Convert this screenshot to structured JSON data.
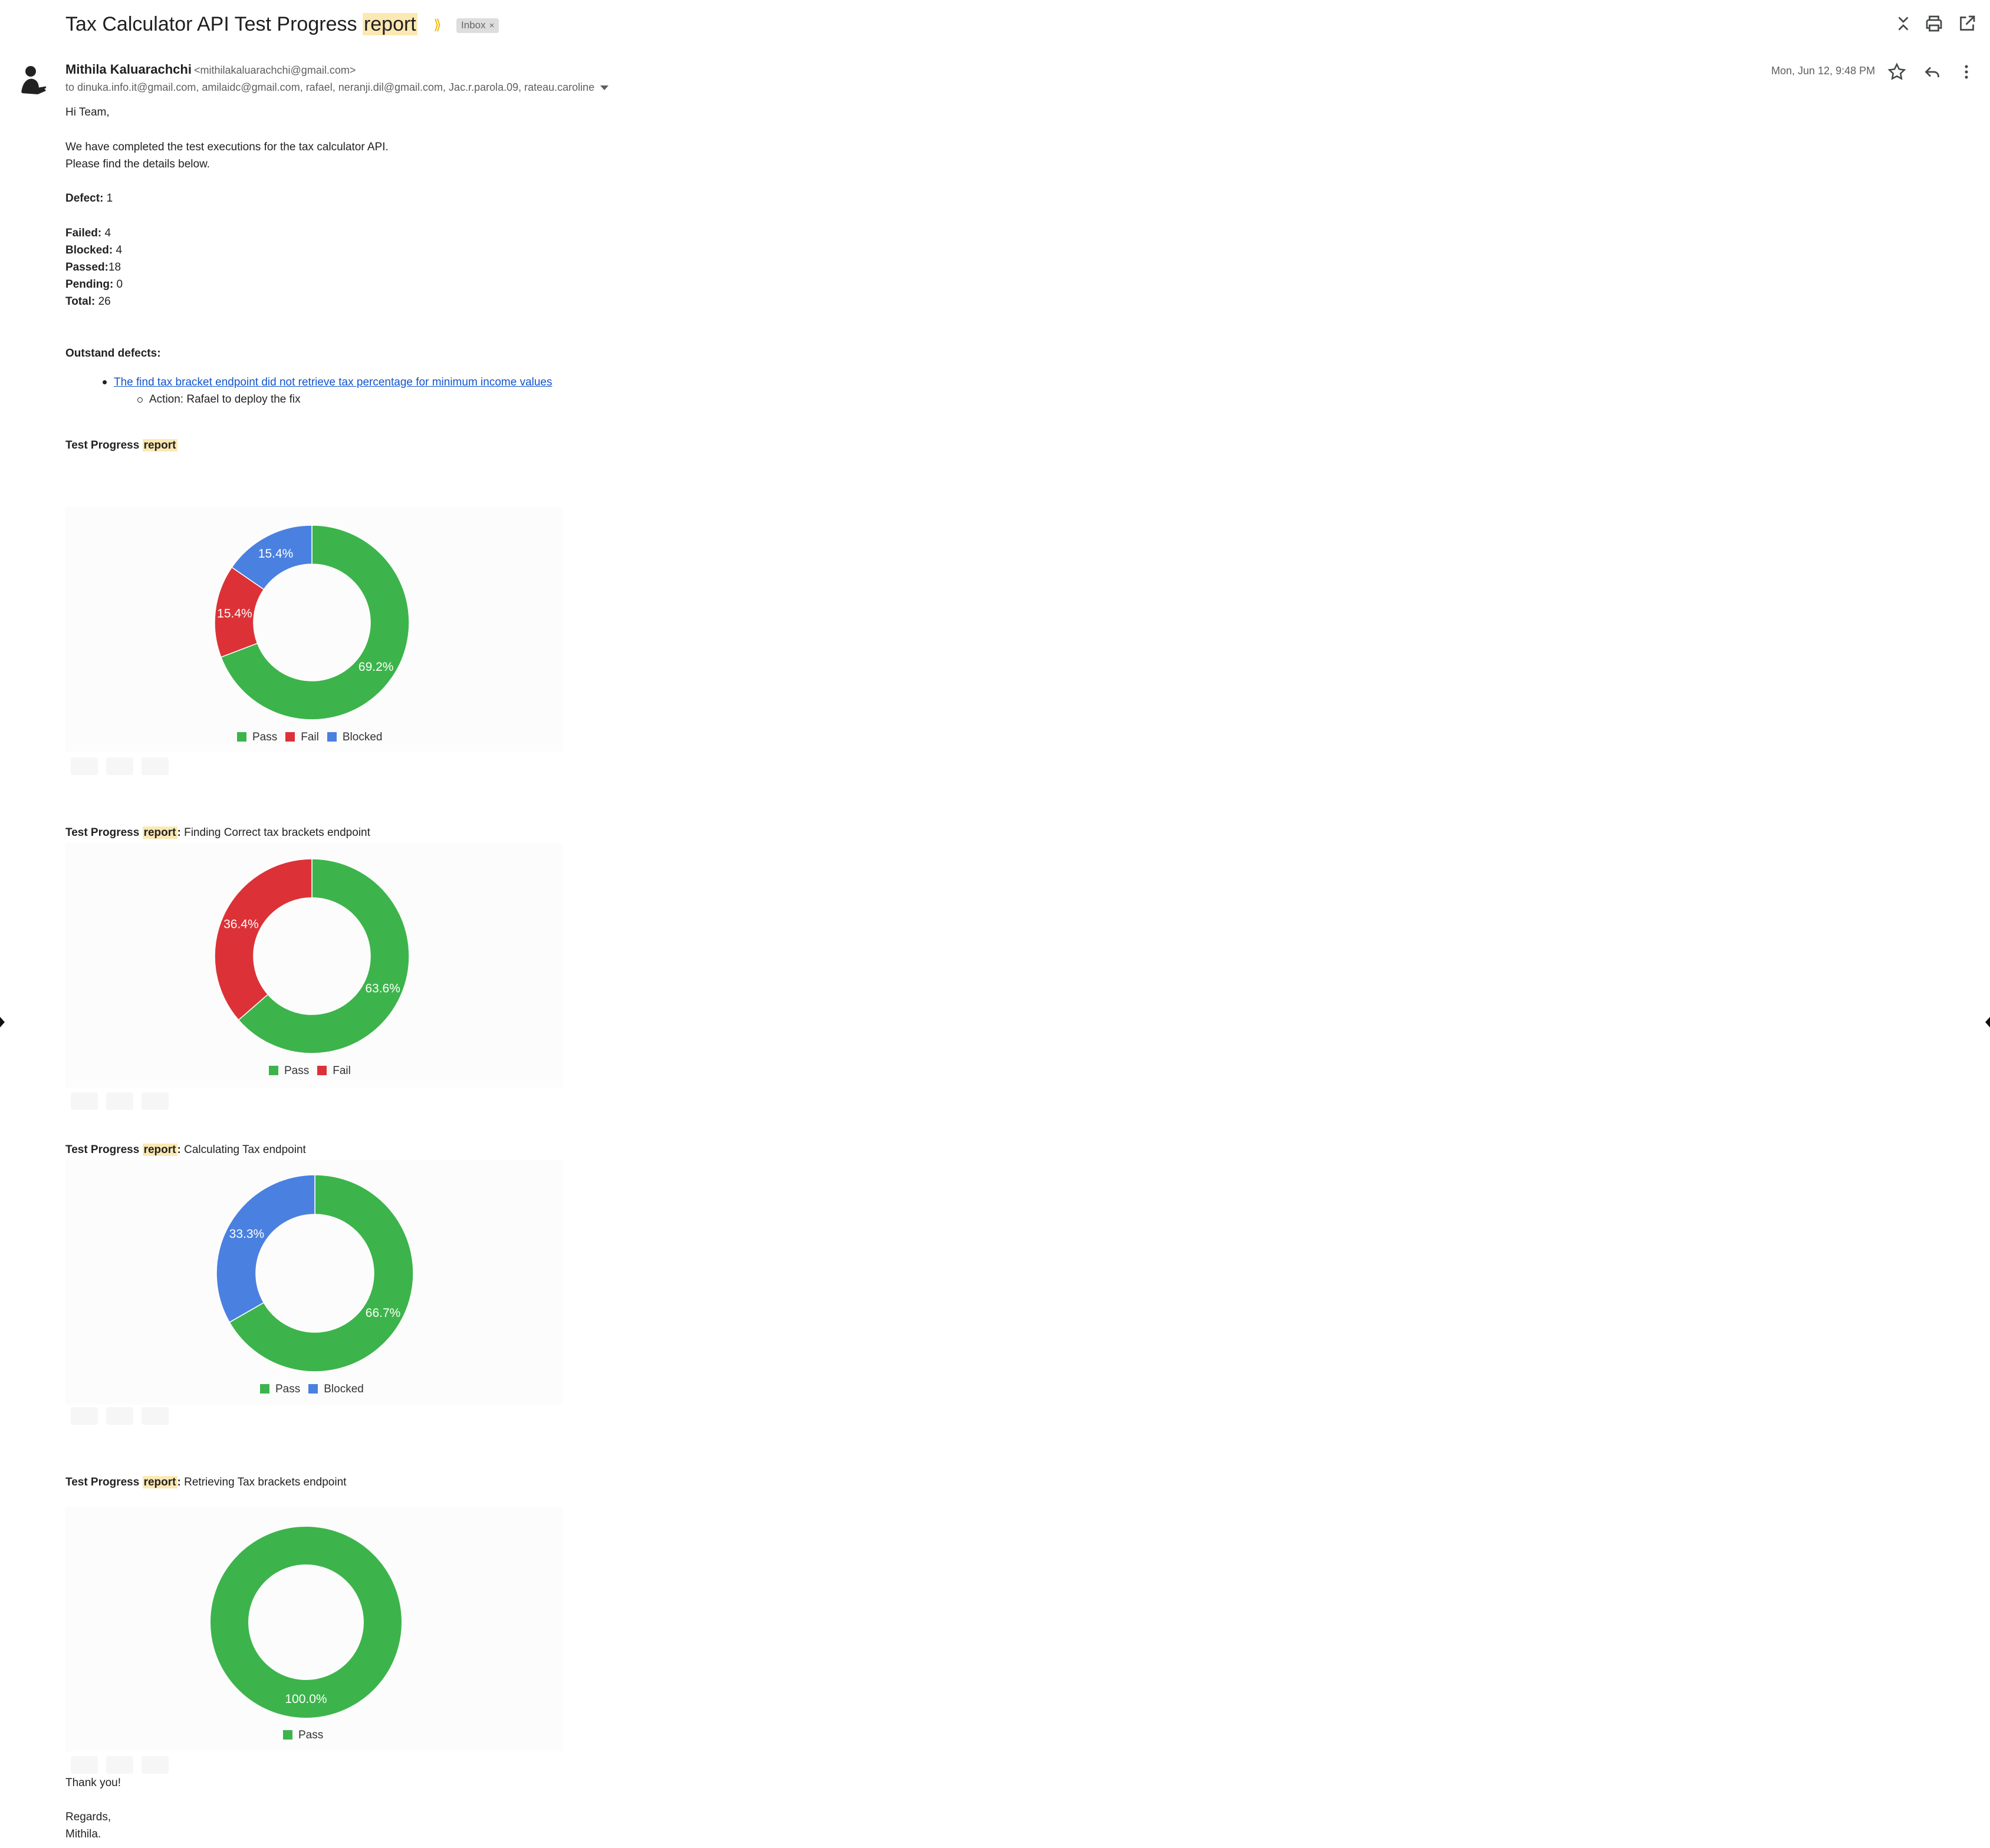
{
  "email": {
    "subject_main": "Tax Calculator API Test Progress",
    "subject_highlight": "report",
    "label": "Inbox",
    "sender_name": "Mithila Kaluarachchi",
    "sender_email": "<mithilakaluarachchi@gmail.com>",
    "recipients": "to dinuka.info.it@gmail.com, amilaidc@gmail.com, rafael, neranji.dil@gmail.com, Jac.r.parola.09, rateau.caroline",
    "date": "Mon, Jun 12, 9:48 PM"
  },
  "icons": {
    "important": "important-marker-icon",
    "label_close": "close-icon",
    "collapse": "collapse-all-icon",
    "print": "print-icon",
    "open_new": "open-in-new-window-icon",
    "star": "star-icon",
    "reply": "reply-icon",
    "more": "more-vertical-icon",
    "recipients_caret": "chevron-down-icon"
  },
  "body": {
    "greeting": "Hi Team,",
    "line1": "We have completed the test executions for the tax calculator API.",
    "line2": "Please find the details below.",
    "defect_label": "Defect:",
    "defect_value": " 1",
    "failed_label": "Failed:",
    "failed_value": " 4",
    "blocked_label": "Blocked:",
    "blocked_value": " 4",
    "passed_label": "Passed:",
    "passed_value": "18",
    "pending_label": "Pending:",
    "pending_value": " 0",
    "total_label": "Total:",
    "total_value": " 26",
    "outstanding_label": "Outstand defects:",
    "defect_link": "The find tax bracket endpoint did not retrieve tax percentage for minimum income values",
    "action": "Action: Rafael to deploy the fix",
    "thanks": "Thank you!",
    "regards": "Regards,",
    "signature": "Mithila."
  },
  "colors": {
    "pass": "#3cb44b",
    "fail": "#dc3237",
    "blocked": "#4a80e0",
    "highlight": "#fce8b2",
    "link": "#1155cc"
  },
  "report_headings": [
    {
      "bold": "Test Progress ",
      "highlight": "report",
      "suffix": ""
    },
    {
      "bold": "Test Progress ",
      "highlight": "report",
      "colon": ":",
      "suffix": " Finding Correct tax brackets endpoint"
    },
    {
      "bold": "Test Progress ",
      "highlight": "report",
      "colon": ":",
      "suffix": " Calculating Tax endpoint"
    },
    {
      "bold": "Test Progress ",
      "highlight": "report",
      "colon": ":",
      "suffix": " Retrieving Tax brackets endpoint"
    }
  ],
  "chart_data": [
    {
      "type": "pie",
      "title": "",
      "donut": true,
      "categories": [
        "Pass",
        "Fail",
        "Blocked"
      ],
      "values": [
        69.2,
        15.4,
        15.4
      ],
      "labels": [
        "69.2%",
        "15.4%",
        "15.4%"
      ],
      "legend": "bottom"
    },
    {
      "type": "pie",
      "title": "",
      "donut": true,
      "categories": [
        "Pass",
        "Fail"
      ],
      "values": [
        63.6,
        36.4
      ],
      "labels": [
        "63.6%",
        "36.4%"
      ],
      "legend": "bottom"
    },
    {
      "type": "pie",
      "title": "",
      "donut": true,
      "categories": [
        "Pass",
        "Blocked"
      ],
      "values": [
        66.7,
        33.3
      ],
      "labels": [
        "66.7%",
        "33.3%"
      ],
      "legend": "bottom"
    },
    {
      "type": "pie",
      "title": "",
      "donut": true,
      "categories": [
        "Pass"
      ],
      "values": [
        100.0
      ],
      "labels": [
        "100.0%"
      ],
      "legend": "bottom"
    }
  ]
}
